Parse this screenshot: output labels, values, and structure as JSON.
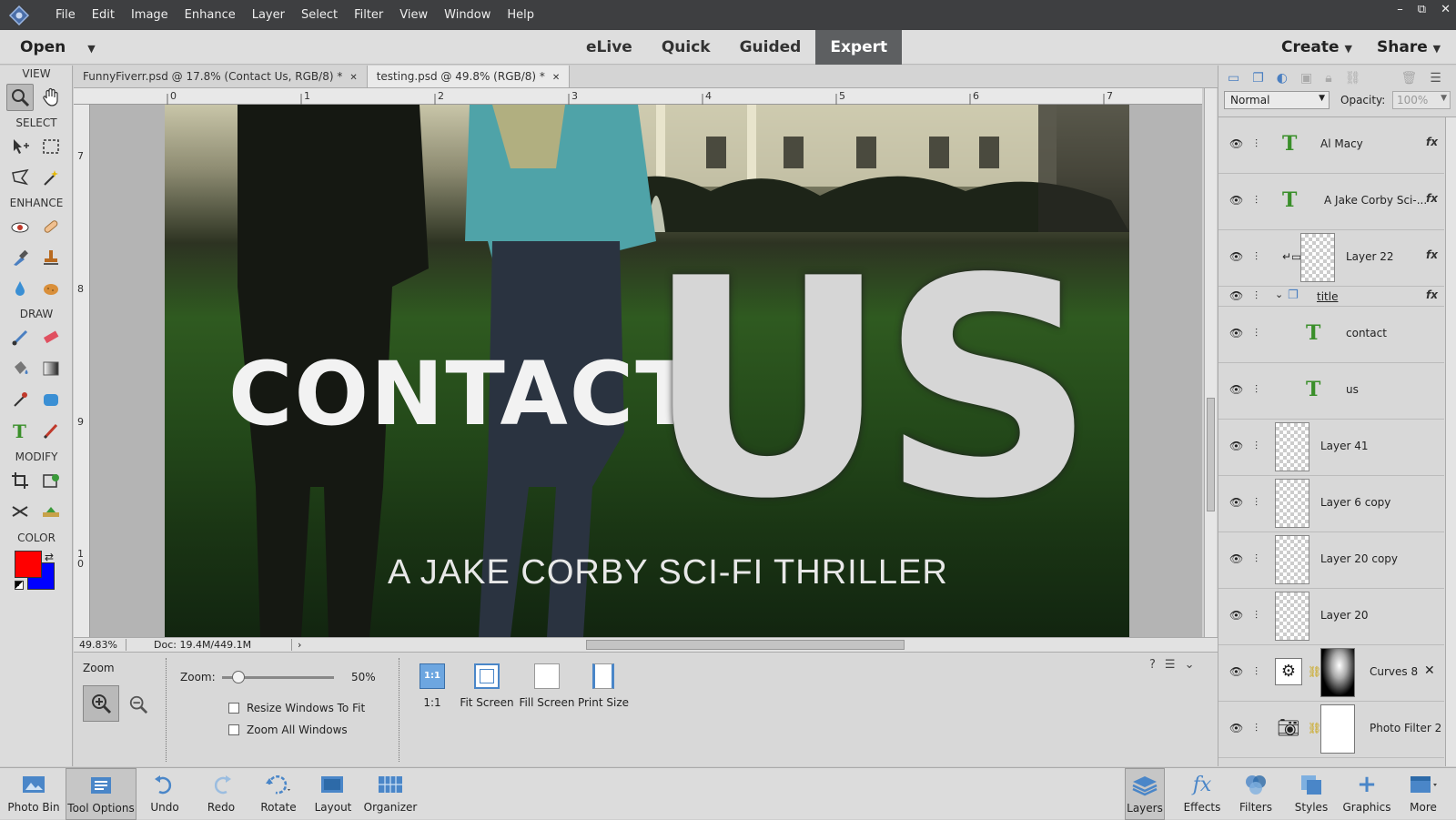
{
  "menubar": {
    "items": [
      "File",
      "Edit",
      "Image",
      "Enhance",
      "Layer",
      "Select",
      "Filter",
      "View",
      "Window",
      "Help"
    ],
    "window_controls": [
      "–",
      "⧉",
      "✕"
    ]
  },
  "modebar": {
    "open_label": "Open",
    "modes": [
      "eLive",
      "Quick",
      "Guided",
      "Expert"
    ],
    "active_mode": "Expert",
    "create_label": "Create",
    "share_label": "Share"
  },
  "toolbox": {
    "sections": [
      "VIEW",
      "SELECT",
      "ENHANCE",
      "DRAW",
      "MODIFY",
      "COLOR"
    ],
    "foreground_color": "#ff0000",
    "background_color": "#0000ff"
  },
  "tabs": [
    {
      "label": "FunnyFiverr.psd @ 17.8% (Contact  Us, RGB/8) *"
    },
    {
      "label": "testing.psd @ 49.8% (RGB/8) *"
    }
  ],
  "ruler": {
    "h": [
      "0",
      "1",
      "2",
      "3",
      "4",
      "5",
      "6",
      "7"
    ],
    "v": [
      "7",
      "8",
      "9",
      "1\n0"
    ]
  },
  "artwork": {
    "title_word1": "CONTACT",
    "title_word2": "US",
    "subtitle": "A JAKE CORBY SCI-FI THRILLER"
  },
  "status": {
    "zoom": "49.83%",
    "doc": "Doc: 19.4M/449.1M"
  },
  "tool_options": {
    "tool_name": "Zoom",
    "zoom_label": "Zoom:",
    "zoom_value": "50%",
    "zoom_fraction": 0.15,
    "resize_windows": "Resize Windows To Fit",
    "zoom_all": "Zoom All Windows",
    "buttons": [
      "1:1",
      "Fit Screen",
      "Fill Screen",
      "Print Size"
    ],
    "one_to_one_icon": "1:1"
  },
  "layers_panel": {
    "blend_mode": "Normal",
    "opacity_label": "Opacity:",
    "opacity_value": "100%",
    "layers": [
      {
        "name": "Al Macy",
        "type": "text",
        "fx": "fx"
      },
      {
        "name": "A Jake Corby Sci-...",
        "type": "text",
        "fx": "fx"
      },
      {
        "name": "Layer 22",
        "type": "raster",
        "fx": "fx"
      },
      {
        "name": "title",
        "type": "group",
        "fx": "fx"
      },
      {
        "name": "contact",
        "type": "text"
      },
      {
        "name": "us",
        "type": "text"
      },
      {
        "name": "Layer 41",
        "type": "raster"
      },
      {
        "name": "Layer 6 copy",
        "type": "raster"
      },
      {
        "name": "Layer 20 copy",
        "type": "raster"
      },
      {
        "name": "Layer 20",
        "type": "raster"
      },
      {
        "name": "Curves 8",
        "type": "adjustment"
      },
      {
        "name": "Photo Filter 2",
        "type": "adjustment"
      }
    ]
  },
  "bottombar": {
    "left": [
      "Photo Bin",
      "Tool Options",
      "Undo",
      "Redo",
      "Rotate",
      "Layout",
      "Organizer"
    ],
    "right": [
      "Layers",
      "Effects",
      "Filters",
      "Styles",
      "Graphics",
      "More"
    ]
  }
}
